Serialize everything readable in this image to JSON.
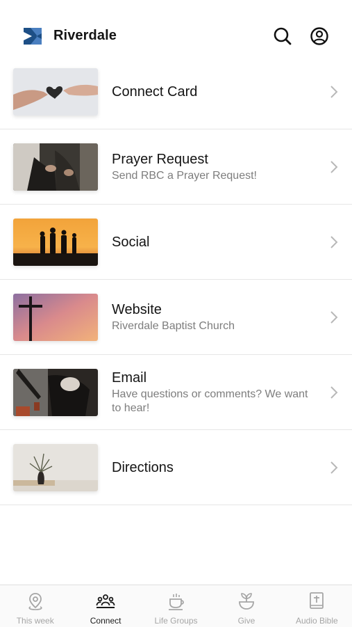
{
  "app": {
    "title": "Riverdale",
    "logo_icon": "riverdale-logo",
    "brand_color": "#1d4f86"
  },
  "header": {
    "search_icon": "search-icon",
    "account_icon": "account-circle-icon"
  },
  "items": [
    {
      "title": "Connect Card",
      "subtitle": "",
      "image": "hands-holding-heart"
    },
    {
      "title": "Prayer Request",
      "subtitle": "Send RBC a Prayer Request!",
      "image": "people-praying"
    },
    {
      "title": "Social",
      "subtitle": "",
      "image": "silhouettes-at-sunset"
    },
    {
      "title": "Website",
      "subtitle": "Riverdale Baptist Church",
      "image": "cross-at-sunset"
    },
    {
      "title": "Email",
      "subtitle": "Have questions or comments? We want to hear!",
      "image": "person-with-coffee"
    },
    {
      "title": "Directions",
      "subtitle": "",
      "image": "vase-with-plant"
    }
  ],
  "tabs": [
    {
      "label": "This week",
      "icon": "map-pin-icon",
      "active": false
    },
    {
      "label": "Connect",
      "icon": "people-group-icon",
      "active": true
    },
    {
      "label": "Life Groups",
      "icon": "coffee-cup-icon",
      "active": false
    },
    {
      "label": "Give",
      "icon": "plant-bowl-icon",
      "active": false
    },
    {
      "label": "Audio Bible",
      "icon": "bible-icon",
      "active": false
    }
  ],
  "colors": {
    "text_primary": "#141414",
    "text_secondary": "#7d7d7d",
    "tab_inactive": "#a5a5a5",
    "tab_active": "#1a1a1a"
  }
}
